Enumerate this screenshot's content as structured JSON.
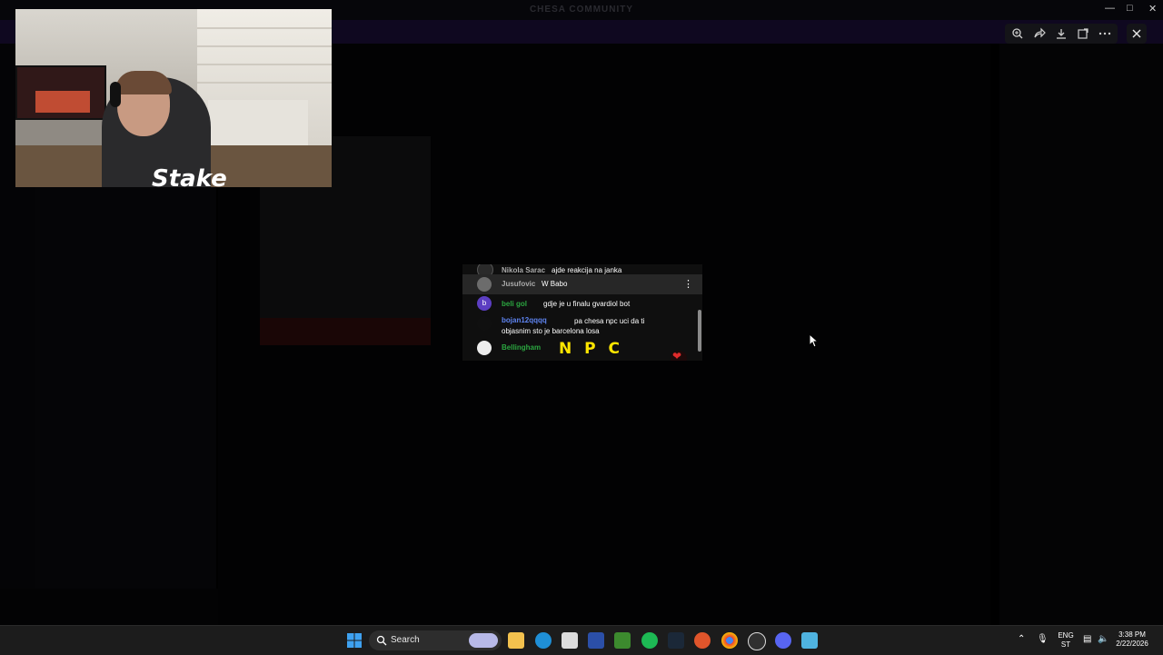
{
  "window": {
    "title": "CHESA COMMUNITY"
  },
  "banner": {
    "text": "",
    "button": ""
  },
  "viewer_toolbar": {
    "icons": [
      "zoom-in-icon",
      "forward-icon",
      "download-icon",
      "open-external-icon",
      "more-icon"
    ],
    "close_icon": "close-icon"
  },
  "webcam": {
    "logo": "Stake"
  },
  "chat": {
    "messages": [
      {
        "author": "Nikola Sarac",
        "text": "ajde reakcija na janka",
        "avatar": "",
        "author_color": "#aaaaaa"
      },
      {
        "author": "Jusufovic",
        "text": "W Babo",
        "avatar": "",
        "author_color": "#aaaaaa",
        "highlighted": true
      },
      {
        "author": "beli gol",
        "text": "gdje je u finalu gvardiol bot",
        "avatar": "b",
        "author_color": "#2ba640"
      },
      {
        "author": "bojan12qqqq",
        "text": "pa chesa npc uci da ti objasnim sto je barcelona losa",
        "avatar": "",
        "author_color": "#5e84f1"
      },
      {
        "author": "Bellingham",
        "text": "",
        "avatar": "",
        "author_color": "#2ba640"
      }
    ],
    "npc_emote": "N P C",
    "more_icon": "vertical-dots-icon",
    "heart_icon": "heart-icon"
  },
  "taskbar": {
    "search_label": "Search",
    "apps": [
      "windows-start-icon",
      "file-explorer-icon",
      "edge-icon",
      "store-icon",
      "app-icon",
      "minecraft-icon",
      "spotify-icon",
      "steam-icon",
      "brave-icon",
      "chrome-icon",
      "obs-icon",
      "discord-icon",
      "notepad-icon"
    ],
    "tray": {
      "lang_top": "ENG",
      "lang_bottom": "ST",
      "time": "3:38 PM",
      "date": "2/22/2026"
    }
  },
  "colors": {
    "accent": "#5865f2",
    "chat_bg": "#0f0f0f",
    "taskbar": "#1c1c1c"
  }
}
